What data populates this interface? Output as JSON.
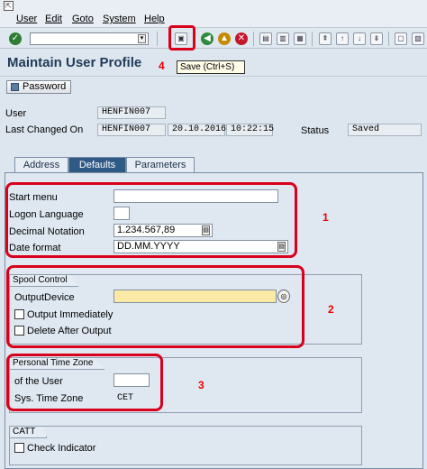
{
  "menu": [
    "User",
    "Edit",
    "Goto",
    "System",
    "Help"
  ],
  "tooltip": "Save   (Ctrl+S)",
  "page_title": "Maintain User Profile",
  "annotations": [
    "1",
    "2",
    "3",
    "4"
  ],
  "password_button": "Password",
  "header": {
    "user_label": "User",
    "user_value": "HENFIN007",
    "last_changed_label": "Last Changed On",
    "last_changed_user": "HENFIN007",
    "last_changed_date": "20.10.2016",
    "last_changed_time": "10:22:15",
    "status_label": "Status",
    "status_value": "Saved"
  },
  "tabs": [
    "Address",
    "Defaults",
    "Parameters"
  ],
  "active_tab": "Defaults",
  "defaults": {
    "start_menu_label": "Start menu",
    "start_menu_value": "",
    "logon_language_label": "Logon Language",
    "logon_language_value": "",
    "decimal_notation_label": "Decimal Notation",
    "decimal_notation_value": "1.234.567,89",
    "date_format_label": "Date format",
    "date_format_value": "DD.MM.YYYY"
  },
  "spool": {
    "title": "Spool Control",
    "output_device_label": "OutputDevice",
    "output_device_value": "",
    "output_immediately_label": "Output Immediately",
    "delete_after_output_label": "Delete After Output"
  },
  "timezone": {
    "title": "Personal Time Zone",
    "of_user_label": "of the User",
    "of_user_value": "",
    "sys_tz_label": "Sys. Time Zone",
    "sys_tz_value": "CET"
  },
  "catt": {
    "title": "CATT",
    "check_indicator_label": "Check Indicator"
  },
  "colors": {
    "highlight": "#d9001b",
    "tab_active": "#2f5a86",
    "required_field": "#fbe9a6"
  },
  "icons": [
    "app-icon",
    "enter-check-icon",
    "save-icon",
    "back-icon",
    "exit-icon",
    "cancel-icon",
    "print-icon",
    "find-icon",
    "find-next-icon",
    "first-page-icon",
    "prev-page-icon",
    "next-page-icon",
    "last-page-icon",
    "new-session-icon",
    "shortcut-icon",
    "help-icon",
    "password-icon"
  ]
}
